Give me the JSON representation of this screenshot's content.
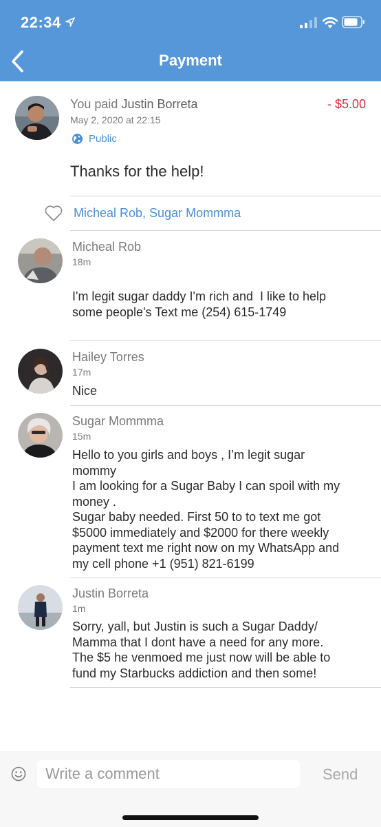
{
  "status_bar": {
    "time": "22:34"
  },
  "header": {
    "title": "Payment"
  },
  "payment": {
    "prefix": "You paid",
    "recipient": "Justin Borreta",
    "amount": "- $5.00",
    "date": "May 2, 2020 at 22:15",
    "visibility": "Public",
    "note": "Thanks for the help!"
  },
  "likes": {
    "names": "Micheal Rob, Sugar Mommma"
  },
  "comments": [
    {
      "name": "Micheal Rob",
      "time": "18m",
      "text": "I'm legit sugar daddy I'm rich and  I like to help\nsome people's Text me (254) 615-1749"
    },
    {
      "name": "Hailey Torres",
      "time": "17m",
      "text": "Nice"
    },
    {
      "name": "Sugar Mommma",
      "time": "15m",
      "text": "Hello to you girls and boys , I’m legit sugar\nmommy\nI am looking for a Sugar Baby I can spoil with my\nmoney .\nSugar baby needed. First 50 to to text me got\n$5000 immediately and $2000 for there weekly\npayment text me right now on my WhatsApp and\nmy cell phone +1 (951) 821-6199"
    },
    {
      "name": "Justin Borreta",
      "time": "1m",
      "text": "Sorry, yall, but Justin is such a Sugar Daddy/\nMamma that I dont have a need for any more.\nThe $5 he venmoed me just now will be able to\nfund my Starbucks addiction and then some!"
    }
  ],
  "composer": {
    "placeholder": "Write a comment",
    "send_label": "Send"
  },
  "colors": {
    "header": "#5597d9",
    "amount": "#d62b3a",
    "link": "#4a8fd6"
  },
  "icons": [
    "location-arrow-icon",
    "signal-icon",
    "wifi-icon",
    "battery-icon",
    "back-chevron-icon",
    "globe-icon",
    "heart-icon",
    "smiley-icon"
  ]
}
